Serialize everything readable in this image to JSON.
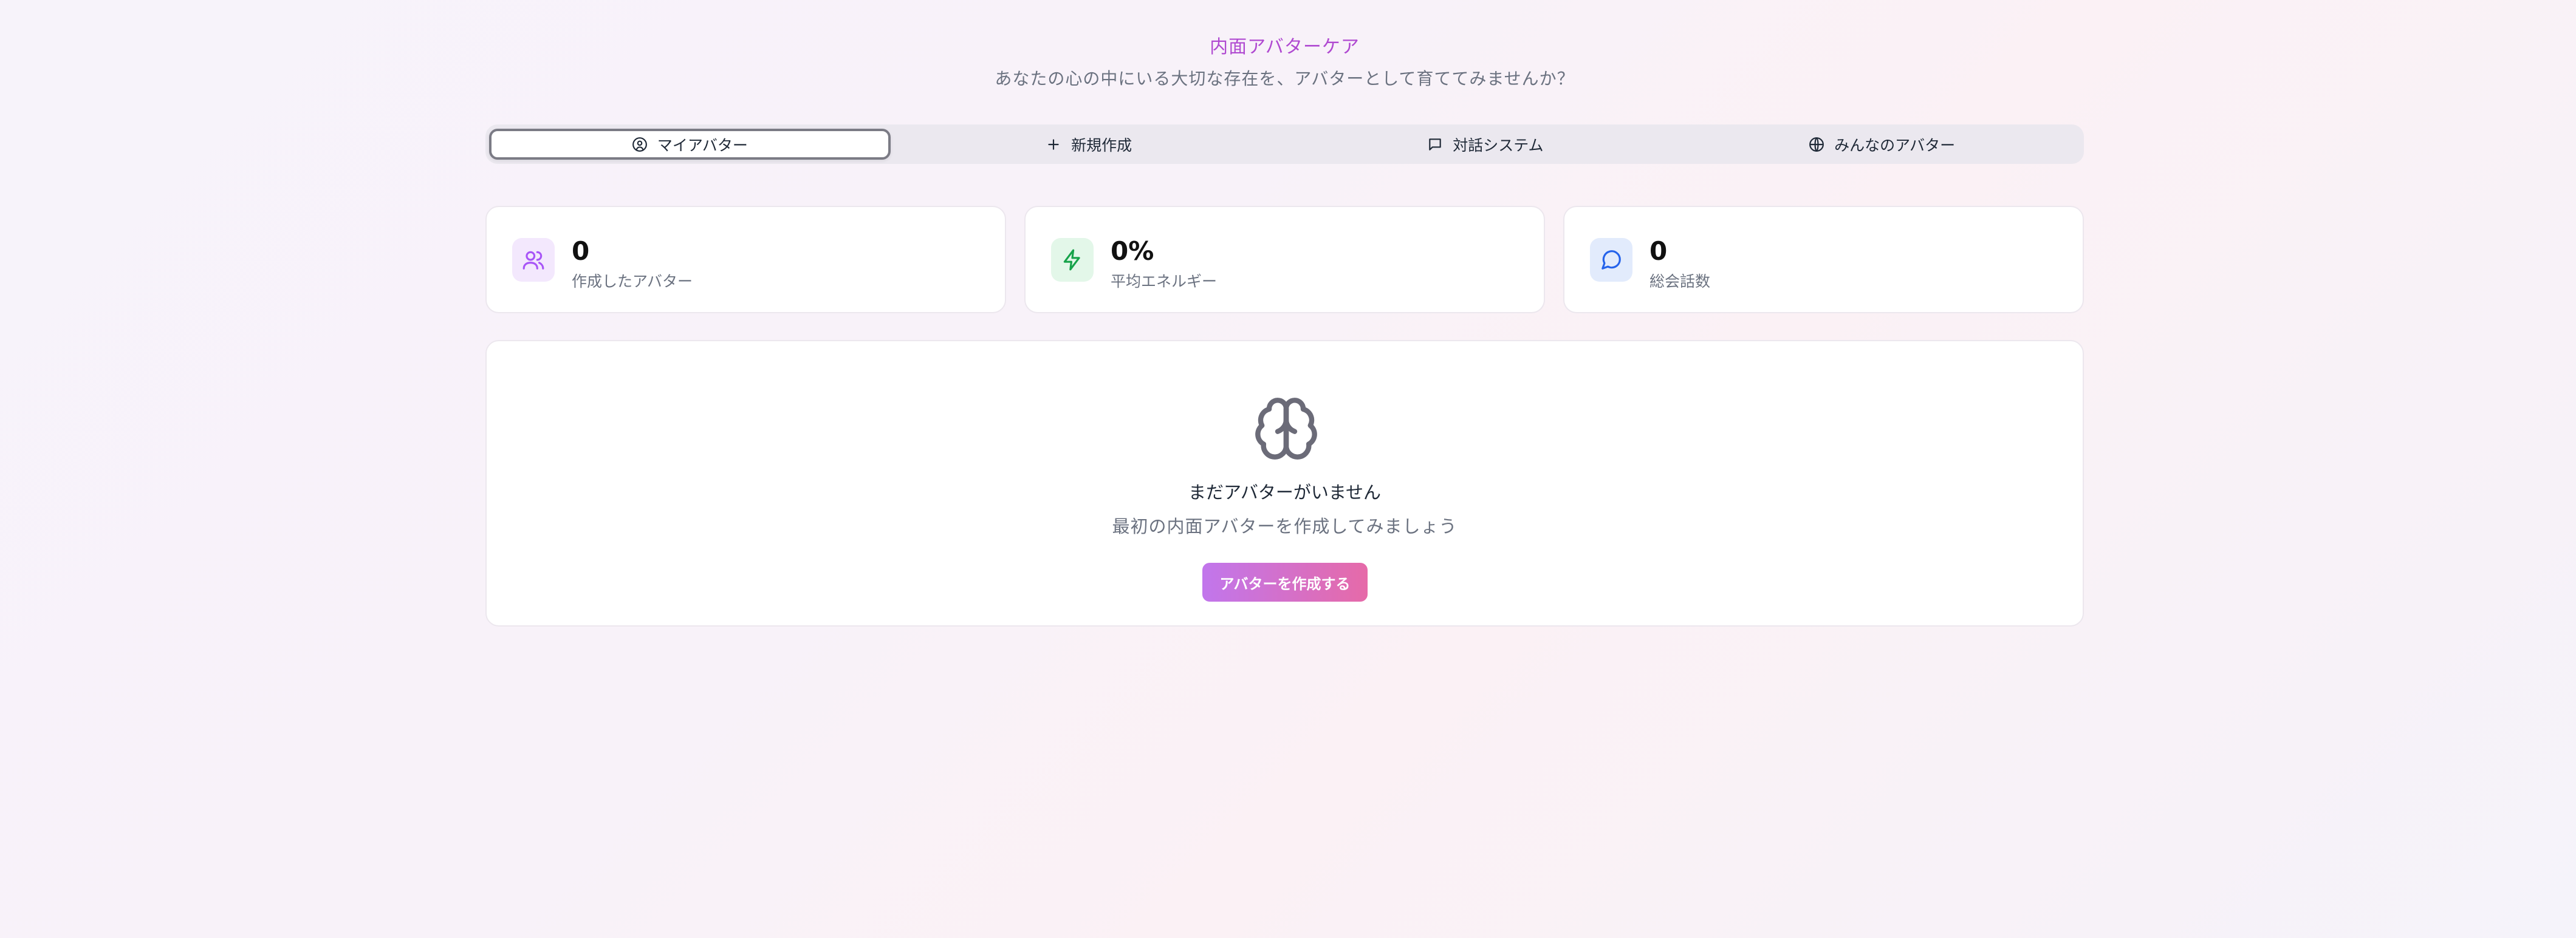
{
  "header": {
    "title": "内面アバターケア",
    "subtitle": "あなたの心の中にいる大切な存在を、アバターとして育ててみませんか？"
  },
  "tabs": [
    {
      "label": "マイアバター",
      "icon": "avatar-face-icon",
      "active": true
    },
    {
      "label": "新規作成",
      "icon": "plus-icon",
      "active": false
    },
    {
      "label": "対話システム",
      "icon": "chat-icon",
      "active": false
    },
    {
      "label": "みんなのアバター",
      "icon": "globe-icon",
      "active": false
    }
  ],
  "stats": [
    {
      "value": "0",
      "label": "作成したアバター",
      "icon": "users-icon",
      "icon_color": "#a855f7",
      "icon_bg": "#f3e8fd"
    },
    {
      "value": "0%",
      "label": "平均エネルギー",
      "icon": "lightning-icon",
      "icon_color": "#16a34a",
      "icon_bg": "#e3f7e9"
    },
    {
      "value": "0",
      "label": "総会話数",
      "icon": "message-circle-icon",
      "icon_color": "#2563eb",
      "icon_bg": "#e2ebfc"
    }
  ],
  "empty_state": {
    "icon": "brain-icon",
    "title": "まだアバターがいません",
    "description": "最初の内面アバターを作成してみましょう",
    "button_label": "アバターを作成する"
  },
  "colors": {
    "accent_title": "#b04ad1",
    "button_gradient_start": "#c176ec",
    "button_gradient_end": "#e66aa8"
  }
}
